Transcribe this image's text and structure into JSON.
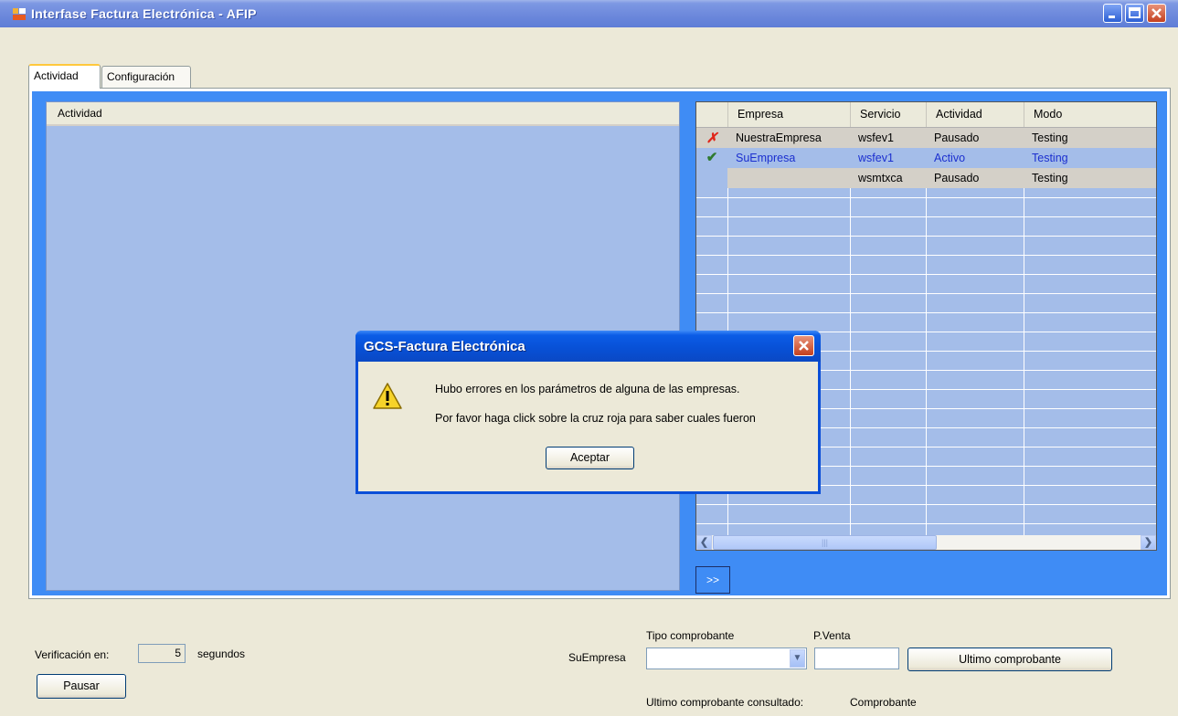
{
  "window": {
    "title": "Interfase Factura Electrónica - AFIP"
  },
  "tabs": [
    {
      "label": "Actividad"
    },
    {
      "label": "Configuración"
    }
  ],
  "activity_panel": {
    "header": "Actividad"
  },
  "grid": {
    "columns": [
      "Empresa",
      "Servicio",
      "Actividad",
      "Modo"
    ],
    "rows": [
      {
        "status_icon": "error-cross-icon",
        "empresa": "NuestraEmpresa",
        "servicio": "wsfev1",
        "actividad": "Pausado",
        "modo": "Testing"
      },
      {
        "status_icon": "check-icon",
        "empresa": "SuEmpresa",
        "servicio": "wsfev1",
        "actividad": "Activo",
        "modo": "Testing"
      },
      {
        "status_icon": "",
        "empresa": "",
        "servicio": "wsmtxca",
        "actividad": "Pausado",
        "modo": "Testing"
      }
    ],
    "expand_label": ">>"
  },
  "bottom": {
    "verificacion_label": "Verificación en:",
    "verificacion_value": "5",
    "segundos_label": "segundos",
    "pausar_label": "Pausar",
    "empresa_label": "SuEmpresa",
    "tipo_comprobante_label": "Tipo comprobante",
    "tipo_comprobante_value": "",
    "pventa_label": "P.Venta",
    "pventa_value": "",
    "ultimo_button_label": "Ultimo comprobante",
    "consultado_label": "Ultimo comprobante consultado:",
    "consultado_value": "Comprobante"
  },
  "dialog": {
    "title": "GCS-Factura Electrónica",
    "line1": "Hubo errores en los parámetros de alguna de las empresas.",
    "line2": "Por favor haga click sobre la cruz roja para saber cuales fueron",
    "ok_label": "Aceptar"
  },
  "colors": {
    "tab_background": "#3f8cf5",
    "list_background": "#a4bde9",
    "selected_row_text": "#1b2fcf",
    "error_icon": "#e0261a",
    "check_icon": "#2f7a2f"
  }
}
